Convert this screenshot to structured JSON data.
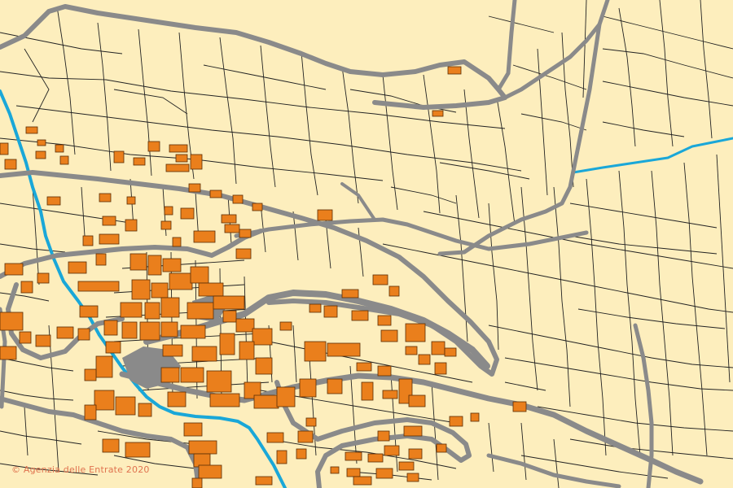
{
  "map": {
    "copyright": "© Agenzia delle Entrate 2020",
    "colors": {
      "background": "#fdeebd",
      "building": "#ea7f1c",
      "road": "#8a8a8a",
      "river": "#1aa7d8",
      "parcel_line": "#222222"
    }
  }
}
